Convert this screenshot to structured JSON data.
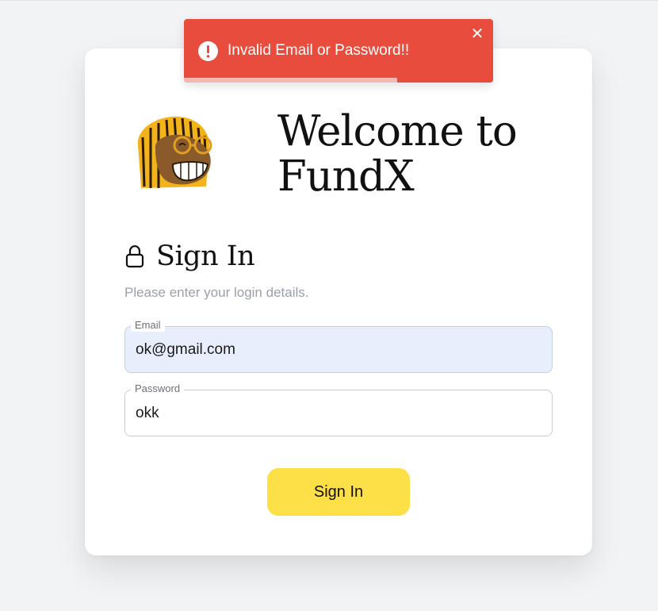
{
  "app": {
    "welcome_line1": "Welcome to",
    "welcome_line2": "FundX"
  },
  "signin": {
    "title": "Sign In",
    "subtitle": "Please enter your login details."
  },
  "form": {
    "email": {
      "label": "Email",
      "value": "ok@gmail.com"
    },
    "password": {
      "label": "Password",
      "value": "okk"
    },
    "submit_label": "Sign In"
  },
  "toast": {
    "message": "Invalid Email or Password!!",
    "close_glyph": "✕",
    "type": "error",
    "progress_remaining": 0.69,
    "color": "#e74c3c"
  },
  "colors": {
    "accent": "#fde047",
    "background": "#f2f3f5",
    "email_autofill": "#e8effc"
  },
  "icons": {
    "mascot": "mascot-avatar-icon",
    "lock": "lock-icon",
    "alert": "alert-circle-icon",
    "close": "close-icon"
  }
}
